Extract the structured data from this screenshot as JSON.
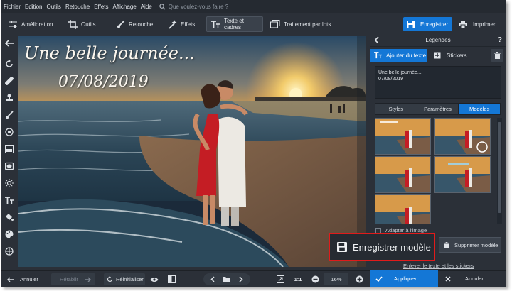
{
  "menu": [
    "Fichier",
    "Edition",
    "Outils",
    "Retouche",
    "Effets",
    "Affichage",
    "Aide"
  ],
  "search": {
    "placeholder": "Que voulez-vous faire ?"
  },
  "toolbar": {
    "tabs": [
      {
        "label": "Amélioration",
        "icon": "sliders-icon",
        "active": false
      },
      {
        "label": "Outils",
        "icon": "crop-icon",
        "active": false
      },
      {
        "label": "Retouche",
        "icon": "brush-icon",
        "active": false
      },
      {
        "label": "Effets",
        "icon": "magic-wand-icon",
        "active": false
      },
      {
        "label": "Texte et cadres",
        "icon": "text-icon",
        "active": true
      },
      {
        "label": "Traitement par lots",
        "icon": "batch-icon",
        "active": false
      }
    ],
    "save_label": "Enregistrer",
    "print_label": "Imprimer"
  },
  "left_tools": [
    "back-arrow-icon",
    "rotate-icon",
    "bandage-icon",
    "stamp-icon",
    "brush-icon",
    "target-icon",
    "gradient-icon",
    "vignette-icon",
    "sun-icon",
    "text-icon",
    "bucket-icon",
    "palette-icon",
    "compass-icon"
  ],
  "canvas": {
    "caption_line1": "Une belle journée...",
    "caption_line2": "07/08/2019"
  },
  "panel": {
    "title": "Légendes",
    "tab_add_text": "Ajouter du texte",
    "tab_stickers": "Stickers",
    "text_line1": "Une belle journée...",
    "text_line2": "07/08/2019",
    "subtabs": [
      "Styles",
      "Paramètres",
      "Modèles"
    ],
    "active_subtab": "Modèles",
    "adapt_label": "Adapter à l'image",
    "adapt_checked": false,
    "delete_model_label": "Supprimer modèle",
    "remove_link": "Enlever le texte et les stickers"
  },
  "callout": {
    "label": "Enregistrer modèle"
  },
  "bottom": {
    "undo": "Annuler",
    "redo": "Rétablir",
    "reset": "Réinitialiser",
    "ratio": "1:1",
    "zoom": "16%",
    "apply": "Appliquer",
    "cancel": "Annuler"
  },
  "colors": {
    "accent": "#1477d6",
    "callout_border": "#e01b1b",
    "panel_bg": "#2b3038"
  }
}
